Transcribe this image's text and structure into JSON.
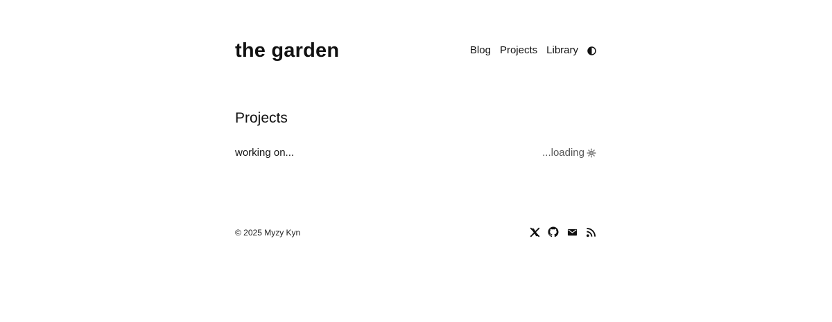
{
  "site": {
    "title": "the garden"
  },
  "nav": {
    "items": [
      {
        "label": "Blog"
      },
      {
        "label": "Projects"
      },
      {
        "label": "Library"
      }
    ],
    "theme_toggle_icon": "contrast-icon"
  },
  "main": {
    "heading": "Projects",
    "row": {
      "left": "working on...",
      "right": "...loading",
      "right_icon": "spinner-icon"
    }
  },
  "footer": {
    "copyright": "© 2025 Myzy Kyn",
    "social_icons": [
      "x-icon",
      "github-icon",
      "mail-icon",
      "rss-icon"
    ]
  },
  "colors": {
    "text": "#111111",
    "muted": "#555555",
    "background": "#ffffff"
  }
}
